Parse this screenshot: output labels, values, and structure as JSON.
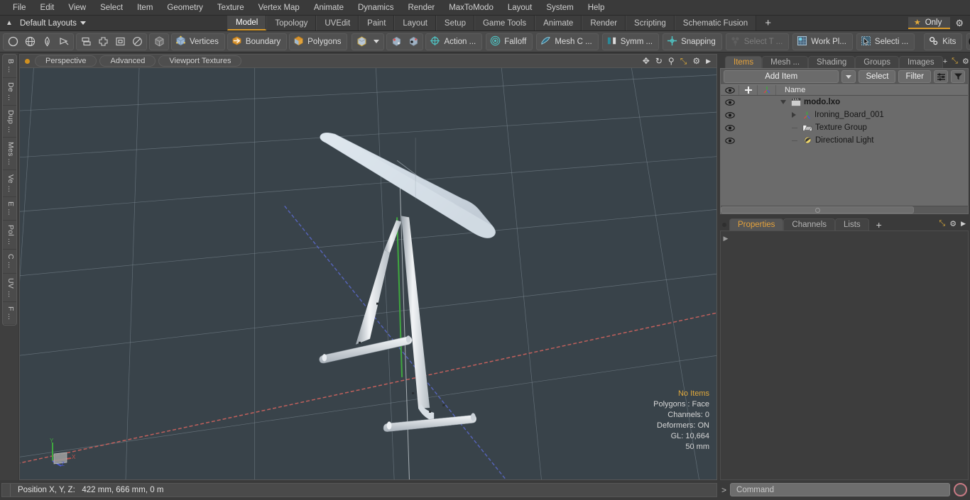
{
  "app": {
    "title": "modo",
    "document": "modo.lxo"
  },
  "menubar": {
    "items": [
      {
        "label": "File"
      },
      {
        "label": "Edit"
      },
      {
        "label": "View"
      },
      {
        "label": "Select"
      },
      {
        "label": "Item"
      },
      {
        "label": "Geometry"
      },
      {
        "label": "Texture"
      },
      {
        "label": "Vertex Map"
      },
      {
        "label": "Animate"
      },
      {
        "label": "Dynamics"
      },
      {
        "label": "Render"
      },
      {
        "label": "MaxToModo"
      },
      {
        "label": "Layout"
      },
      {
        "label": "System"
      },
      {
        "label": "Help"
      }
    ]
  },
  "layoutbar": {
    "preset_label": "Default Layouts",
    "tabs": [
      {
        "label": "Model",
        "active": true
      },
      {
        "label": "Topology",
        "active": false
      },
      {
        "label": "UVEdit",
        "active": false
      },
      {
        "label": "Paint",
        "active": false
      },
      {
        "label": "Layout",
        "active": false
      },
      {
        "label": "Setup",
        "active": false
      },
      {
        "label": "Game Tools",
        "active": false
      },
      {
        "label": "Animate",
        "active": false
      },
      {
        "label": "Render",
        "active": false
      },
      {
        "label": "Scripting",
        "active": false
      },
      {
        "label": "Schematic Fusion",
        "active": false
      }
    ],
    "add_tab_label": "+",
    "only_label": "Only",
    "star_glyph": "★"
  },
  "toolbar": {
    "shape_icons": [
      {
        "name": "circle-icon"
      },
      {
        "name": "globe-icon"
      },
      {
        "name": "pen-icon"
      },
      {
        "name": "cut-icon"
      }
    ],
    "transform_icons": [
      {
        "name": "array-icon"
      },
      {
        "name": "mirror-icon"
      },
      {
        "name": "bevel-icon"
      },
      {
        "name": "smooth-icon"
      }
    ],
    "cube_icon": {
      "name": "cube-icon"
    },
    "selection_modes": [
      {
        "label": "Vertices",
        "icon": "vertices-cube-icon"
      },
      {
        "label": "Boundary",
        "icon": "boundary-cube-icon"
      },
      {
        "label": "Polygons",
        "icon": "polygons-cube-icon"
      }
    ],
    "mode_dropdown": {
      "icon": "cube-mode-icon",
      "caret": "▼"
    },
    "snap_toggles": [
      {
        "name": "snap-item-a-icon"
      },
      {
        "name": "snap-item-b-icon"
      }
    ],
    "action_buttons": [
      {
        "label": "Action   ...",
        "icon": "action-center-icon",
        "dim": false
      },
      {
        "label": "Falloff",
        "icon": "falloff-icon",
        "dim": false
      },
      {
        "label": "Mesh C ...",
        "icon": "mesh-constraint-icon",
        "dim": false
      },
      {
        "label": "Symm ...",
        "icon": "symmetry-icon",
        "dim": false
      },
      {
        "label": "Snapping",
        "icon": "snapping-icon",
        "dim": false
      },
      {
        "label": "Select T ...",
        "icon": "select-through-icon",
        "dim": true
      },
      {
        "label": "Work Pl...",
        "icon": "work-plane-icon",
        "dim": false
      },
      {
        "label": "Selecti ...",
        "icon": "selection-icon",
        "dim": false
      },
      {
        "label": "Kits",
        "icon": "kits-gear-icon",
        "dim": false
      }
    ],
    "logo_buttons": [
      {
        "name": "modo-logo-icon"
      },
      {
        "name": "unreal-logo-icon"
      }
    ]
  },
  "left_tabs": {
    "items": [
      {
        "label": "B ..."
      },
      {
        "label": "De ..."
      },
      {
        "label": "Dup ..."
      },
      {
        "label": "Mes ..."
      },
      {
        "label": "Ve ..."
      },
      {
        "label": "E ..."
      },
      {
        "label": "Pol ..."
      },
      {
        "label": "C ..."
      },
      {
        "label": "UV ..."
      },
      {
        "label": "F ..."
      }
    ]
  },
  "viewport": {
    "header": {
      "view_mode": "Perspective",
      "shading": "Advanced",
      "textures": "Viewport Textures",
      "icons": [
        {
          "name": "move-view-icon",
          "glyph": "✥"
        },
        {
          "name": "rotate-view-icon",
          "glyph": "↻"
        },
        {
          "name": "zoom-view-icon",
          "glyph": "⚲"
        },
        {
          "name": "maximize-view-icon",
          "glyph": "⤡"
        },
        {
          "name": "viewport-settings-gear-icon",
          "glyph": "⚙"
        },
        {
          "name": "viewport-more-arrow-icon",
          "glyph": "▶"
        }
      ]
    },
    "stats": {
      "selection": "No Items",
      "polygons": "Polygons : Face",
      "channels": "Channels: 0",
      "deformers": "Deformers: ON",
      "gl": "GL: 10,664",
      "grid": "50 mm"
    },
    "colors": {
      "background": "#39434a",
      "grid": "#8d9aa4",
      "axis_x": "#c9625e",
      "axis_y": "#3fa83f",
      "axis_z": "#5a68c8",
      "model_light": "#d4dce4",
      "model_mid": "#bfc9d3"
    },
    "gizmo": {
      "x_label": "X",
      "y_label": "Y",
      "z_label": "Z"
    }
  },
  "right_panel": {
    "top_tabs": [
      {
        "label": "Items",
        "active": true
      },
      {
        "label": "Mesh ...",
        "active": false
      },
      {
        "label": "Shading",
        "active": false
      },
      {
        "label": "Groups",
        "active": false
      },
      {
        "label": "Images",
        "active": false
      }
    ],
    "top_tabs_extra": [
      {
        "name": "add-tab-icon",
        "glyph": "+"
      },
      {
        "name": "expand-panel-icon",
        "glyph": "⤡"
      },
      {
        "name": "panel-settings-gear-icon",
        "glyph": "⚙"
      },
      {
        "name": "panel-more-arrow-icon",
        "glyph": "▶"
      }
    ],
    "items": {
      "add_item_label": "Add Item",
      "add_item_caret": "▼",
      "select_label": "Select",
      "filter_label": "Filter",
      "sort_icon": "sort-icon",
      "funnel_icon": "funnel-icon",
      "columns": [
        {
          "name": "visibility-eye-icon",
          "label": ""
        },
        {
          "name": "lock-cross-icon",
          "label": ""
        },
        {
          "name": "render-icon",
          "label": ""
        },
        {
          "name": "name-column",
          "label": "Name"
        }
      ],
      "rows": [
        {
          "label": "modo.lxo",
          "icon": "scene-clapper-icon",
          "indent": 0,
          "expander": "down",
          "bold": true
        },
        {
          "label": "Ironing_Board_001",
          "icon": "mesh-item-icon",
          "indent": 1,
          "expander": "right",
          "bold": false
        },
        {
          "label": "Texture Group",
          "icon": "texture-group-icon",
          "indent": 1,
          "expander": "none",
          "bold": false
        },
        {
          "label": "Directional Light",
          "icon": "directional-light-icon",
          "indent": 1,
          "expander": "none",
          "bold": false
        }
      ]
    },
    "bottom_tabs": [
      {
        "label": "Properties",
        "active": true
      },
      {
        "label": "Channels",
        "active": false
      },
      {
        "label": "Lists",
        "active": false
      }
    ],
    "bottom_tabs_add": "+"
  },
  "statusbar": {
    "position_label": "Position X, Y, Z:",
    "position_value": "422 mm, 666 mm, 0 m",
    "command_caret": ">",
    "command_placeholder": "Command",
    "command_value": "",
    "record_button": "record-command-icon"
  }
}
